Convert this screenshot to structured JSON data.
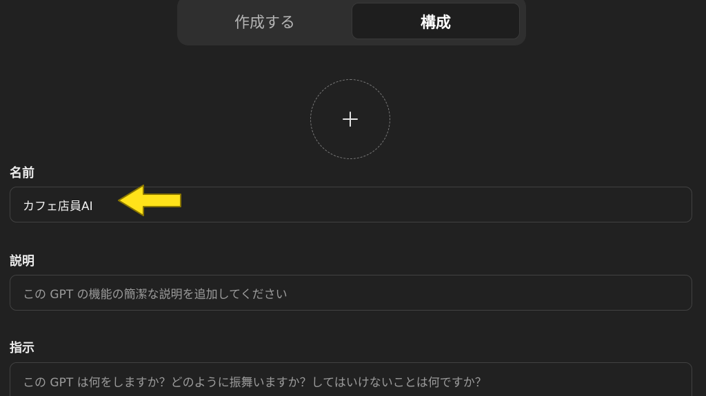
{
  "tabs": [
    {
      "label": "作成する",
      "active": false
    },
    {
      "label": "構成",
      "active": true
    }
  ],
  "avatar": {
    "icon": "plus-icon"
  },
  "fields": {
    "name": {
      "label": "名前",
      "value": "カフェ店員AI"
    },
    "description": {
      "label": "説明",
      "placeholder": "この GPT の機能の簡潔な説明を追加してください"
    },
    "instructions": {
      "label": "指示",
      "placeholder": "この GPT は何をしますか？どのように振舞いますか？してはいけないことは何ですか？"
    }
  },
  "annotation": {
    "icon": "arrow-left-icon",
    "color": "#ffe21a"
  },
  "colors": {
    "background": "#212121",
    "panel": "#2f2f2f",
    "border": "#424242"
  }
}
